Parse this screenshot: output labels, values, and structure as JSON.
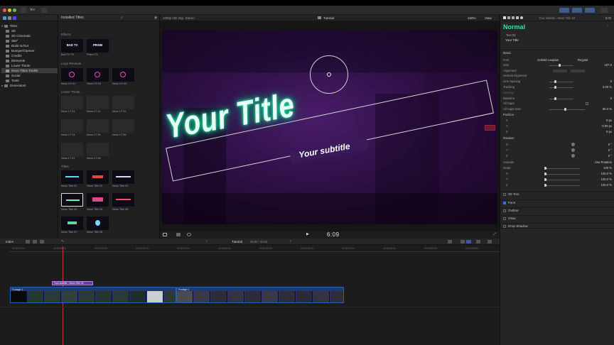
{
  "toolbar": {
    "lights": [
      "#ee5c52",
      "#f1bf2f",
      "#5ac647"
    ],
    "key_label": "⌘K"
  },
  "library": {
    "header": "Titles",
    "items": [
      {
        "label": "3D"
      },
      {
        "label": "3D Cinematic"
      },
      {
        "label": "360°"
      },
      {
        "label": "Build In/Out"
      },
      {
        "label": "Bumper/Opener"
      },
      {
        "label": "Credits"
      },
      {
        "label": "Elements"
      },
      {
        "label": "Lower Thirds"
      },
      {
        "label": "Neon Titles Toolkit"
      },
      {
        "label": "Social"
      },
      {
        "label": "Tools"
      }
    ],
    "generators": "Generators"
  },
  "browser": {
    "title": "Installed Titles",
    "sections": {
      "effects": "Effects",
      "logo": "Logo Reveals",
      "lower": "Lower Thirds",
      "titles": "Titles"
    },
    "effects": [
      {
        "thumb": "BAD TV",
        "label": "Bad TV FX"
      },
      {
        "thumb": "PRISM",
        "label": "Prism FX"
      }
    ],
    "logos": [
      {
        "label": "Neon LR 01"
      },
      {
        "label": "Neon LR 02"
      },
      {
        "label": "Neon LR 03"
      }
    ],
    "lower_thirds": [
      {
        "label": "Neon LT 01"
      },
      {
        "label": "Neon LT 02"
      },
      {
        "label": "Neon LT 03"
      },
      {
        "label": "Neon LT 04"
      },
      {
        "label": "Neon LT 05"
      },
      {
        "label": "Neon LT 06"
      },
      {
        "label": "Neon LT 07"
      },
      {
        "label": "Neon LT 08"
      }
    ],
    "titles": [
      {
        "label": "Neon Title 01"
      },
      {
        "label": "Neon Title 02"
      },
      {
        "label": "Neon Title 03"
      },
      {
        "label": "Neon Title 04"
      },
      {
        "label": "Neon Title 05"
      },
      {
        "label": "Neon Title 06"
      },
      {
        "label": "Neon Title 07"
      },
      {
        "label": "Neon Title 08"
      }
    ]
  },
  "viewer": {
    "format": "1080p HD 25p, Stereo",
    "project": "Tutorial",
    "zoom": "150%",
    "view": "View",
    "title_text": "Your Title",
    "subtitle_text": "Your subtitle",
    "timecode": "6:09"
  },
  "inspector": {
    "header": "Your subtitle - Neon Title 04",
    "duration": "5:00",
    "effect_name": "Normal",
    "text_layer": "Text 02",
    "text_value": "Your Title",
    "basic_label": "Basic",
    "rows": [
      {
        "label": "Font",
        "value": "Gobold Lowplus"
      },
      {
        "label": "Size",
        "value": "187.0"
      },
      {
        "label": "Alignment",
        "value": ""
      },
      {
        "label": "Vertical Alignment",
        "value": ""
      },
      {
        "label": "Line Spacing",
        "value": "0"
      },
      {
        "label": "Tracking",
        "value": "3.00 %"
      },
      {
        "label": "Kerning",
        "value": ""
      },
      {
        "label": "Baseline",
        "value": "0"
      },
      {
        "label": "All Caps",
        "value": ""
      },
      {
        "label": "All Caps Size",
        "value": "80.0 %"
      },
      {
        "label": "Position",
        "value": ""
      },
      {
        "label": "X",
        "value": "0 px"
      },
      {
        "label": "Y",
        "value": "0.99 px"
      },
      {
        "label": "Z",
        "value": "0 px"
      },
      {
        "label": "Rotation",
        "value": ""
      },
      {
        "label": "X",
        "value": "0 °"
      },
      {
        "label": "Y",
        "value": "0 °"
      },
      {
        "label": "Z",
        "value": "0 °"
      },
      {
        "label": "Animate",
        "value": "Use Rotation"
      },
      {
        "label": "Scale",
        "value": "100 %"
      },
      {
        "label": "X",
        "value": "100.0 %"
      },
      {
        "label": "Y",
        "value": "100.0 %"
      },
      {
        "label": "Z",
        "value": "100.0 %"
      }
    ],
    "font_weight": "Regular",
    "sections": [
      {
        "label": "3D Text",
        "checked": false
      },
      {
        "label": "Face",
        "checked": true
      },
      {
        "label": "Outline",
        "checked": false
      },
      {
        "label": "Glow",
        "checked": false
      },
      {
        "label": "Drop Shadow",
        "checked": false
      }
    ]
  },
  "timeline": {
    "index": "Index",
    "project": "Tutorial",
    "duration": "05:00 / 40:03",
    "ticks": [
      "00:00:00:00",
      "00:00:05:00",
      "00:00:10:00",
      "00:00:15:00",
      "00:00:20:00",
      "00:00:25:00",
      "00:00:30:00",
      "00:00:35:00",
      "00:00:40:00",
      "00:00:45:00",
      "00:00:50:00",
      "00:00:55:00"
    ],
    "title_clip": "Your subtitle - Neon Title 04",
    "clip1": "Footage 1",
    "clip2": "Footage 2"
  }
}
